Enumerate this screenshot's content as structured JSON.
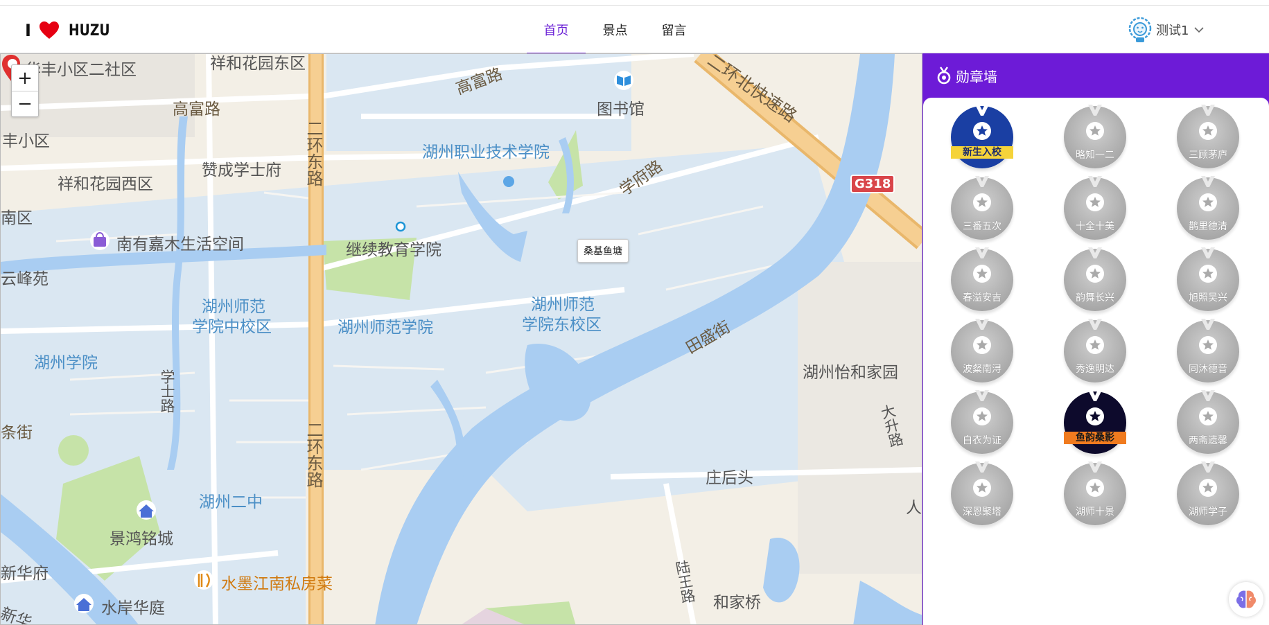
{
  "header": {
    "logo_prefix": "I",
    "logo_brand": "HUZU",
    "nav": [
      {
        "label": "首页",
        "active": true
      },
      {
        "label": "景点",
        "active": false
      },
      {
        "label": "留言",
        "active": false
      }
    ],
    "user_name": "测试1"
  },
  "map": {
    "zoom_in": "+",
    "zoom_out": "−",
    "marker_label": "桑基鱼塘",
    "highway_badge": "G318",
    "labels": [
      "华丰小区二社区",
      "祥和花园东区",
      "高富路",
      "高富路",
      "图书馆",
      "二环北快速路",
      "丰小区",
      "湖州职业技术学院",
      "祥和花园西区",
      "赞成学士府",
      "学府路",
      "南区",
      "南有嘉木生活空间",
      "继续教育学院",
      "云峰苑",
      "湖州师范",
      "学院中校区",
      "湖州师范学院",
      "湖州师范",
      "学院东校区",
      "田盛街",
      "湖州学院",
      "湖州怡和家园",
      "学士路",
      "条街",
      "庄后头",
      "大升路",
      "湖州二中",
      "景鸿铭城",
      "新华府",
      "水墨江南私房菜",
      "陆王路",
      "和家桥",
      "水岸华庭",
      "新华",
      "人",
      "二环东路",
      "二环东路"
    ]
  },
  "sidebar": {
    "title": "勋章墙",
    "badges": [
      {
        "name": "新生入校",
        "state": "earned-blue"
      },
      {
        "name": "略知一二",
        "state": "locked"
      },
      {
        "name": "三顾茅庐",
        "state": "locked"
      },
      {
        "name": "三番五次",
        "state": "locked"
      },
      {
        "name": "十全十美",
        "state": "locked"
      },
      {
        "name": "鹊里德清",
        "state": "locked"
      },
      {
        "name": "春溢安吉",
        "state": "locked"
      },
      {
        "name": "韵舞长兴",
        "state": "locked"
      },
      {
        "name": "旭照吴兴",
        "state": "locked"
      },
      {
        "name": "波粲南浔",
        "state": "locked"
      },
      {
        "name": "秀逸明达",
        "state": "locked"
      },
      {
        "name": "同沐德音",
        "state": "locked"
      },
      {
        "name": "白衣为证",
        "state": "locked"
      },
      {
        "name": "鱼韵桑影",
        "state": "earned-dark"
      },
      {
        "name": "两斋遗馨",
        "state": "locked"
      },
      {
        "name": "深恩聚塔",
        "state": "locked"
      },
      {
        "name": "湖师十景",
        "state": "locked"
      },
      {
        "name": "湖师学子",
        "state": "locked"
      }
    ]
  },
  "colors": {
    "accent": "#6d1bd7",
    "nav_active": "#6a1fd6",
    "map_water": "#a9cdf2",
    "map_campus": "#d8e6f2",
    "map_ground": "#f3efe6",
    "highway": "#f3c37e",
    "badge_locked": "#aaaaaa"
  },
  "icons": [
    "heart-icon",
    "lion-avatar-icon",
    "chevron-down-icon",
    "medal-icon",
    "map-pin-icon",
    "library-icon",
    "shop-icon",
    "home-icon",
    "restaurant-icon",
    "star-icon",
    "brain-icon"
  ]
}
